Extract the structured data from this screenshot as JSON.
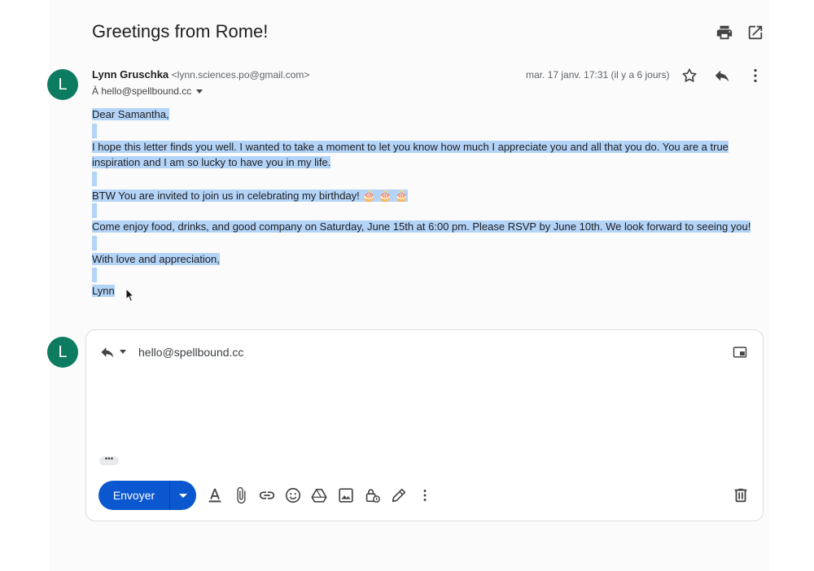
{
  "email": {
    "subject": "Greetings from Rome!",
    "avatar_letter": "L",
    "sender_name": "Lynn Gruschka",
    "sender_email": "<lynn.sciences.po@gmail.com>",
    "to_line": "À hello@spellbound.cc",
    "date": "mar. 17 janv. 17:31 (il y a 6 jours)",
    "body": {
      "greeting": "Dear Samantha,",
      "para1_line1": "I hope this letter finds you well. I wanted to take a moment to let you know how much I appreciate you and all that you do. You are a true",
      "para1_line2": "inspiration and I am so lucky to have you in my life.",
      "para2": "BTW You are invited to join us in celebrating my birthday!",
      "para2_emoji": "🎂 🎂 🎂",
      "para3": "Come enjoy food, drinks, and good company on Saturday, June 15th at 6:00 pm. Please RSVP by June 10th. We look forward to seeing you!",
      "closing": "With love and appreciation,",
      "signature": "Lynn"
    }
  },
  "reply": {
    "avatar_letter": "L",
    "to": "hello@spellbound.cc",
    "quoted_dots": "•••",
    "send_label": "Envoyer"
  },
  "icons": {
    "top": [
      "print-icon",
      "open-in-new-window-icon"
    ],
    "header_actions": [
      "star-icon",
      "reply-icon",
      "more-vert-icon"
    ],
    "toolbar": [
      "format-text-icon",
      "attach-icon",
      "link-icon",
      "emoji-icon",
      "drive-icon",
      "insert-photo-icon",
      "confidential-lock-icon",
      "signature-pen-icon",
      "more-vert-icon"
    ],
    "discard": "trash-icon"
  },
  "colors": {
    "send_button": "#0b57d0",
    "avatar": "#0c7b5f",
    "selection": "#b3d3f7"
  }
}
